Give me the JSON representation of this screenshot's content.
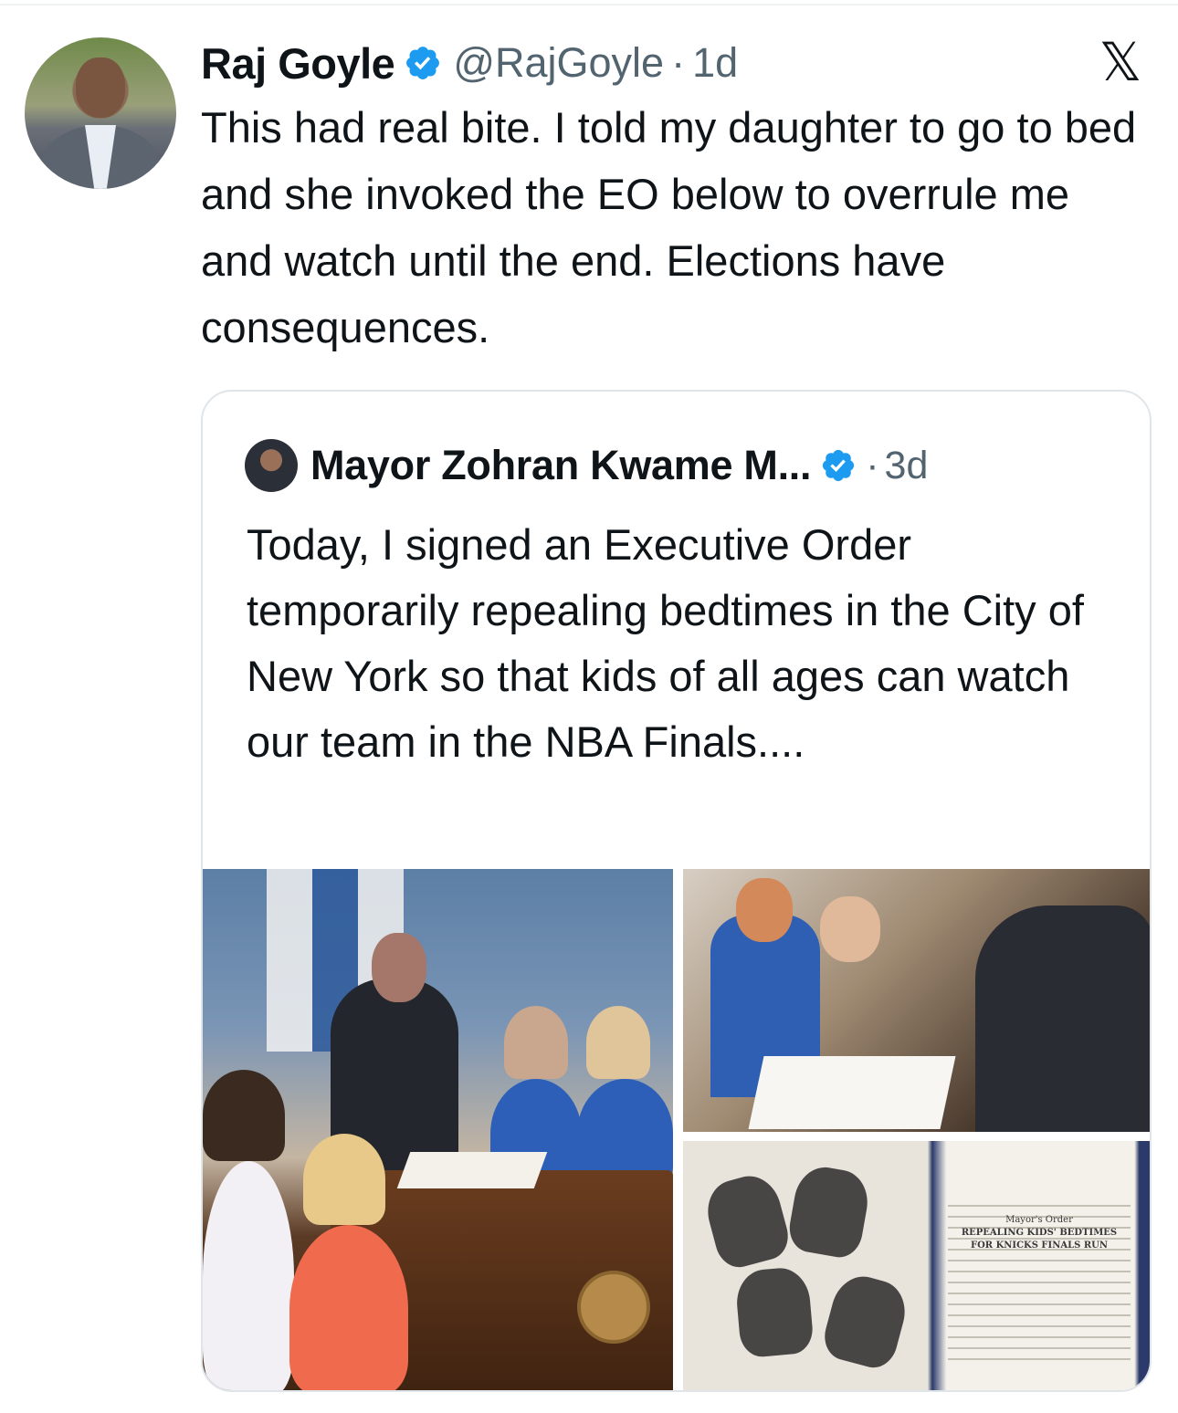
{
  "tweet": {
    "author_name": "Raj Goyle",
    "handle": "@RajGoyle",
    "separator": "·",
    "time": "1d",
    "text": "This had real bite. I told my daughter to go to bed and she invoked the EO below to overrule me and watch until the end. Elections have consequences."
  },
  "x_logo": "𝕏",
  "quoted": {
    "author_name": "Mayor Zohran Kwame M...",
    "separator": "·",
    "time": "3d",
    "text": "Today, I signed an Executive Order temporarily repealing bedtimes in the City of New York so that kids of all ages can watch our team in the NBA Finals...."
  },
  "media": {
    "image3_doc_title": "Mayor's Order",
    "image3_doc_heading_1": "REPEALING KIDS' BEDTIMES",
    "image3_doc_heading_2": "FOR KNICKS FINALS RUN"
  },
  "colors": {
    "text": "#0f1419",
    "secondary": "#536471",
    "verified": "#1d9bf0",
    "border": "#dfe5e9"
  }
}
